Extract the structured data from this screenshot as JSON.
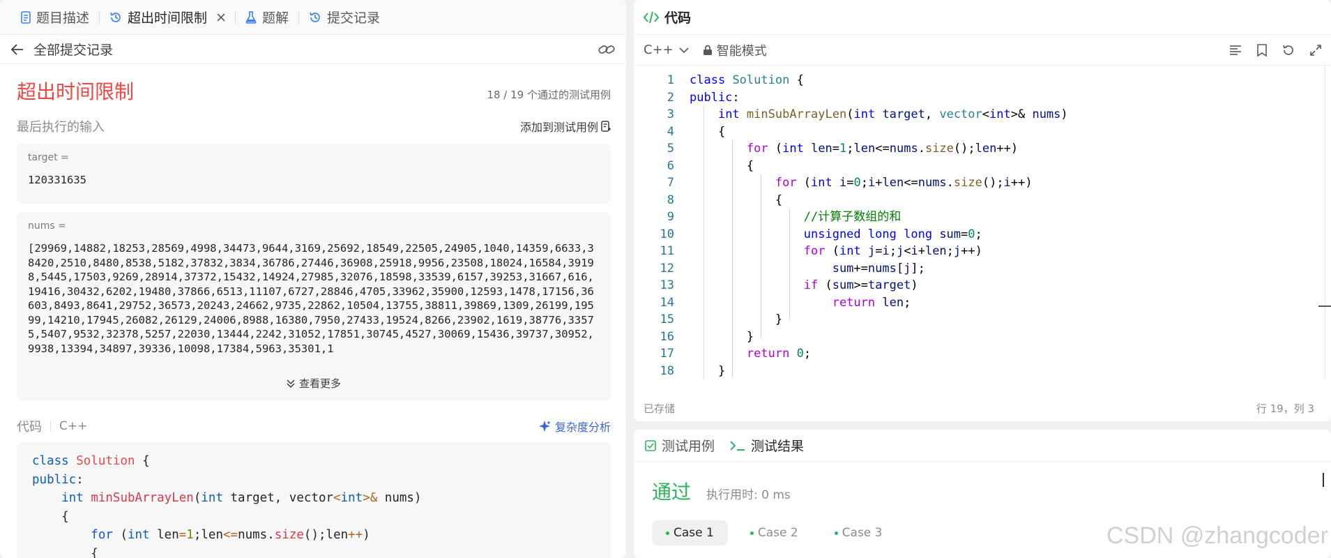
{
  "left": {
    "tabs": [
      {
        "label": "题目描述",
        "icon": "document-icon"
      },
      {
        "label": "超出时间限制",
        "icon": "history-icon",
        "active": true
      },
      {
        "label": "题解",
        "icon": "flask-icon"
      },
      {
        "label": "提交记录",
        "icon": "history-icon"
      }
    ],
    "back_label": "全部提交记录",
    "status_title": "超出时间限制",
    "pass_count": "18 / 19  个通过的测试用例",
    "last_input_label": "最后执行的输入",
    "add_case_label": "添加到测试用例",
    "target_label": "target =",
    "target_value": "120331635",
    "nums_label": "nums =",
    "nums_value": "[29969,14882,18253,28569,4998,34473,9644,3169,25692,18549,22505,24905,1040,14359,6633,38420,2510,8480,8538,5182,37832,3834,36786,27446,36908,25918,9956,23508,18024,16584,39198,5445,17503,9269,28914,37372,15432,14924,27985,32076,18598,33539,6157,39253,31667,616,19416,30432,6202,19480,37866,6513,11107,6727,28846,4705,33962,35900,12593,1478,17156,36603,8493,8641,29752,36573,20243,24662,9735,22862,10504,13755,38811,39869,1309,26199,19599,14210,17945,26082,26129,24006,8988,16380,7950,27433,19524,8266,23902,1619,38776,33575,5407,9532,32378,5257,22030,13444,2242,31052,17851,30745,4527,30069,15436,39737,30952,9938,13394,34897,39336,10098,17384,5963,35301,1",
    "see_more": "查看更多",
    "code_label": "代码",
    "code_lang": "C++",
    "complexity_label": "复杂度分析"
  },
  "editor": {
    "title": "代码",
    "language": "C++",
    "mode": "智能模式",
    "saved": "已存储",
    "cursor": "行 19，列 3"
  },
  "tests": {
    "tab_cases": "测试用例",
    "tab_result": "测试结果",
    "result": "通过",
    "exec_time": "执行用时: 0 ms",
    "cases": [
      "Case 1",
      "Case 2",
      "Case 3"
    ],
    "watermark": "CSDN @zhangcoder"
  },
  "colors": {
    "error": "#ef4743",
    "success": "#2db55d",
    "accent": "#3b63e0"
  }
}
